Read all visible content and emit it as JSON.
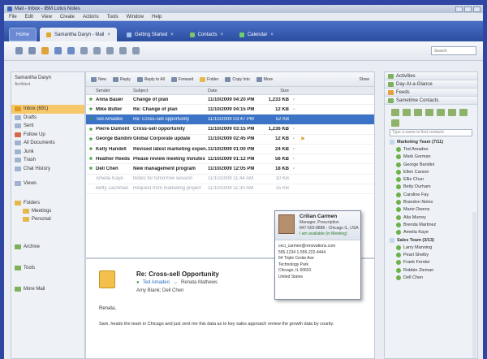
{
  "window": {
    "title": "Mail - Inbox - IBM Lotus Notes"
  },
  "menu": [
    "File",
    "Edit",
    "View",
    "Create",
    "Actions",
    "Tools",
    "Window",
    "Help"
  ],
  "tabs": [
    {
      "label": "Home"
    },
    {
      "label": "Samantha Daryn - Mail"
    },
    {
      "label": "Getting Started"
    },
    {
      "label": "Contacts"
    },
    {
      "label": "Calendar"
    }
  ],
  "toolbar": {
    "search_placeholder": "Search"
  },
  "leftnav": {
    "owner": "Samantha Daryn",
    "owner_sub": "Architect",
    "items": [
      "Inbox (691)",
      "Drafts",
      "Sent",
      "Follow Up",
      "All Documents",
      "Junk",
      "Trash",
      "Chat History",
      "Views",
      "Folders",
      "Meetings",
      "Personal",
      "Archive",
      "Tools",
      "More Mail"
    ]
  },
  "list_toolbar": [
    "New",
    "Reply",
    "Reply to All",
    "Forward",
    "Folder",
    "Copy Into",
    "More",
    "Show"
  ],
  "columns": [
    "Sender",
    "Subject",
    "Date",
    "Size"
  ],
  "messages": [
    {
      "sender": "Anna Bauer",
      "subject": "Change of plan",
      "date": "11/10/2009 04:20 PM",
      "size": "1,233 KB",
      "state": "unread"
    },
    {
      "sender": "Mike Butler",
      "subject": "Re: Change of plan",
      "date": "11/10/2009 04:15 PM",
      "size": "12 KB",
      "state": "unread"
    },
    {
      "sender": "Ted Amadeo",
      "subject": "Re: Cross-sell opportunity",
      "date": "11/10/2009 03:47 PM",
      "size": "52 KB",
      "state": "selected"
    },
    {
      "sender": "Pierre Dumont",
      "subject": "Cross-sell opportunity",
      "date": "11/10/2009 03:15 PM",
      "size": "1,236 KB",
      "state": "unread"
    },
    {
      "sender": "George Bandini",
      "subject": "Global Corporate update",
      "date": "11/10/2009 02:45 PM",
      "size": "12 KB",
      "state": "unread"
    },
    {
      "sender": "Kelly Handell",
      "subject": "Revised latest marketing expen...",
      "date": "11/10/2009 01:00 PM",
      "size": "24 KB",
      "state": "unread"
    },
    {
      "sender": "Heather Reeds",
      "subject": "Please review meeting minutes",
      "date": "11/10/2009 01:12 PM",
      "size": "56 KB",
      "state": "unread"
    },
    {
      "sender": "Dell Chen",
      "subject": "New management program",
      "date": "11/10/2009 12:05 PM",
      "size": "18 KB",
      "state": "unread"
    },
    {
      "sender": "Amelia Kaye",
      "subject": "Notes for tomorrow session",
      "date": "11/10/2009 11:44 AM",
      "size": "10 KB",
      "state": "read"
    },
    {
      "sender": "Betty Zachman",
      "subject": "Request from marketing project",
      "date": "11/10/2009 11:30 AM",
      "size": "15 KB",
      "state": "read"
    }
  ],
  "preview": {
    "subject": "Re: Cross-sell Opportunity",
    "from": "Ted Amadeo",
    "to": "Renata Mathews",
    "cc": "Amy Blank; Dell Chen",
    "greeting": "Renata,",
    "body": "Sam, heads the team in Chicago and just sent me this data as to key sales approach review the growth data by county."
  },
  "sidebar": {
    "panels": [
      "Activities",
      "Day-At-a-Glance",
      "Feeds",
      "Sametime Contacts"
    ],
    "contact_search": "Type a name to find contacts",
    "contacts": [
      {
        "name": "Marketing Team (7/11)",
        "group": true
      },
      {
        "name": "Ted Amadeo",
        "group": false
      },
      {
        "name": "Mark Gorman",
        "group": false
      },
      {
        "name": "George Bandini",
        "group": false
      },
      {
        "name": "Ellen Carson",
        "group": false
      },
      {
        "name": "Ellie Chun",
        "group": false
      },
      {
        "name": "Betty Durham",
        "group": false
      },
      {
        "name": "Caroline Fay",
        "group": false
      },
      {
        "name": "Brandon Noles",
        "group": false
      },
      {
        "name": "Marie Owens",
        "group": false
      },
      {
        "name": "Alia Murrey",
        "group": false
      },
      {
        "name": "Brenda Martinez",
        "group": false
      },
      {
        "name": "Amelia Kaye",
        "group": false
      },
      {
        "name": "Sales Team (3/13)",
        "group": true
      },
      {
        "name": "Larry Manning",
        "group": false
      },
      {
        "name": "Pearl Shelby",
        "group": false
      },
      {
        "name": "Frank Fender",
        "group": false
      },
      {
        "name": "Robbie Zieman",
        "group": false
      },
      {
        "name": "Dell Chen",
        "group": false
      }
    ]
  },
  "business_card": {
    "name": "Crilian Carmen",
    "title": "Manager, Prescription",
    "phone": "847-555-8888 - Chicago IL, USA",
    "status": "I am available (in Meeting)",
    "lines": [
      "ceci_carmen@renovations.com",
      "555-1234  1-555-222-4444",
      "64 Triple Cedar Ave",
      "Technology Park",
      "Chicago, IL 60601",
      "United States"
    ]
  },
  "colors": {
    "selection": "#3b73c6",
    "accent": "#2c4e9f",
    "nav_selected": "#f7c86a"
  }
}
